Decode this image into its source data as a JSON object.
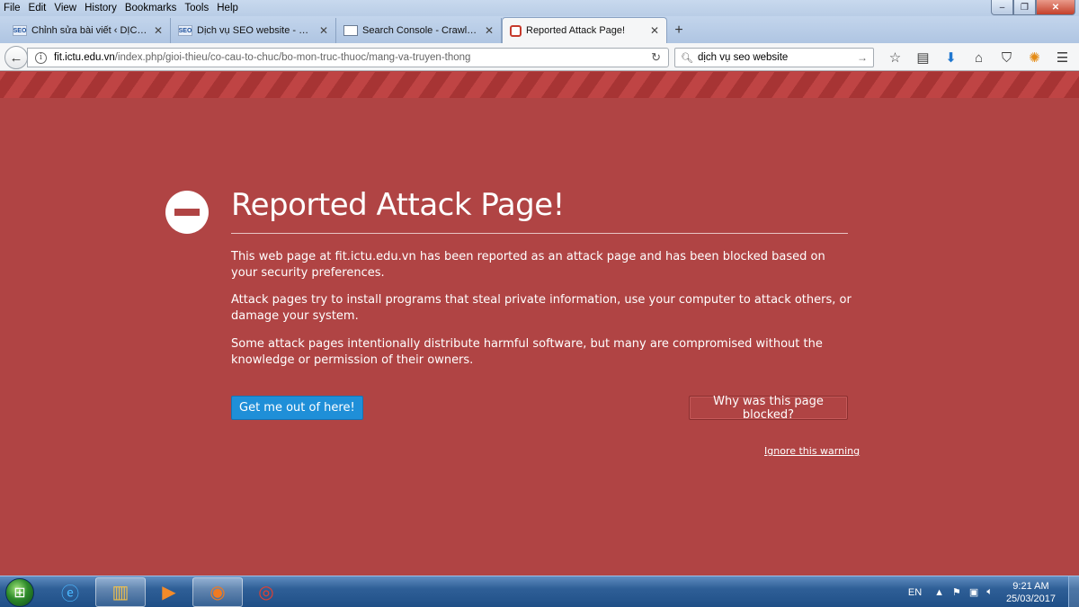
{
  "menu": [
    "File",
    "Edit",
    "View",
    "History",
    "Bookmarks",
    "Tools",
    "Help"
  ],
  "window_controls": {
    "minimize": "‒",
    "maximize": "❐",
    "close": "✕"
  },
  "tabs": [
    {
      "label": "Chỉnh sửa bài viết ‹ DỊCH V...",
      "icon": "seo-favicon",
      "active": false
    },
    {
      "label": "Dịch vụ SEO website - DỊC...",
      "icon": "seo-favicon",
      "active": false
    },
    {
      "label": "Search Console - Crawl URL",
      "icon": "page-favicon",
      "active": false
    },
    {
      "label": "Reported Attack Page!",
      "icon": "warning-favicon",
      "active": true
    }
  ],
  "tab_icon_text": "SEO",
  "newtab": "+",
  "nav": {
    "url_host": "fit.ictu.edu.vn",
    "url_path": "/index.php/gioi-thieu/co-cau-to-chuc/bo-mon-truc-thuoc/mang-va-truyen-thong",
    "search_value": "dịch vụ seo website"
  },
  "page": {
    "title": "Reported Attack Page!",
    "paragraphs": [
      "This web page at fit.ictu.edu.vn has been reported as an attack page and has been blocked based on your security preferences.",
      "Attack pages try to install programs that steal private information, use your computer to attack others, or damage your system.",
      "Some attack pages intentionally distribute harmful software, but many are compromised without the knowledge or permission of their owners."
    ],
    "primary_button": "Get me out of here!",
    "secondary_button": "Why was this page blocked?",
    "ignore_link": "Ignore this warning",
    "colors": {
      "background": "#b04444",
      "primary_button": "#1f8fd8"
    }
  },
  "taskbar": {
    "apps": [
      "internet-explorer",
      "windows-explorer",
      "media-player",
      "firefox",
      "chrome"
    ],
    "language": "EN",
    "time": "9:21 AM",
    "date": "25/03/2017"
  }
}
